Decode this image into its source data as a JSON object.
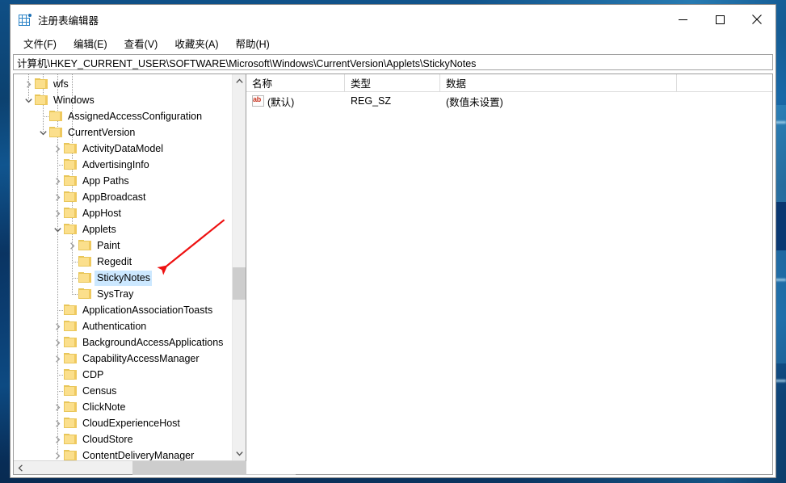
{
  "window": {
    "title": "注册表编辑器",
    "app_icon": "registry-editor-icon",
    "minimize_label": "最小化",
    "maximize_label": "最大化",
    "close_label": "关闭"
  },
  "menubar": {
    "items": [
      {
        "label": "文件(F)"
      },
      {
        "label": "编辑(E)"
      },
      {
        "label": "查看(V)"
      },
      {
        "label": "收藏夹(A)"
      },
      {
        "label": "帮助(H)"
      }
    ]
  },
  "address": {
    "path": "计算机\\HKEY_CURRENT_USER\\SOFTWARE\\Microsoft\\Windows\\CurrentVersion\\Applets\\StickyNotes"
  },
  "tree": {
    "items": [
      {
        "label": "wfs",
        "indent": 1,
        "expander": "collapsed",
        "selected": false
      },
      {
        "label": "Windows",
        "indent": 1,
        "expander": "expanded",
        "selected": false
      },
      {
        "label": "AssignedAccessConfiguration",
        "indent": 2,
        "expander": "none",
        "selected": false
      },
      {
        "label": "CurrentVersion",
        "indent": 2,
        "expander": "expanded",
        "selected": false
      },
      {
        "label": "ActivityDataModel",
        "indent": 3,
        "expander": "collapsed",
        "selected": false
      },
      {
        "label": "AdvertisingInfo",
        "indent": 3,
        "expander": "none",
        "selected": false
      },
      {
        "label": "App Paths",
        "indent": 3,
        "expander": "collapsed",
        "selected": false
      },
      {
        "label": "AppBroadcast",
        "indent": 3,
        "expander": "collapsed",
        "selected": false
      },
      {
        "label": "AppHost",
        "indent": 3,
        "expander": "collapsed",
        "selected": false
      },
      {
        "label": "Applets",
        "indent": 3,
        "expander": "expanded",
        "selected": false
      },
      {
        "label": "Paint",
        "indent": 4,
        "expander": "collapsed",
        "selected": false
      },
      {
        "label": "Regedit",
        "indent": 4,
        "expander": "none",
        "selected": false
      },
      {
        "label": "StickyNotes",
        "indent": 4,
        "expander": "none",
        "selected": true
      },
      {
        "label": "SysTray",
        "indent": 4,
        "expander": "none",
        "selected": false
      },
      {
        "label": "ApplicationAssociationToasts",
        "indent": 3,
        "expander": "none",
        "selected": false
      },
      {
        "label": "Authentication",
        "indent": 3,
        "expander": "collapsed",
        "selected": false
      },
      {
        "label": "BackgroundAccessApplications",
        "indent": 3,
        "expander": "collapsed",
        "selected": false
      },
      {
        "label": "CapabilityAccessManager",
        "indent": 3,
        "expander": "collapsed",
        "selected": false
      },
      {
        "label": "CDP",
        "indent": 3,
        "expander": "none",
        "selected": false
      },
      {
        "label": "Census",
        "indent": 3,
        "expander": "none",
        "selected": false
      },
      {
        "label": "ClickNote",
        "indent": 3,
        "expander": "collapsed",
        "selected": false
      },
      {
        "label": "CloudExperienceHost",
        "indent": 3,
        "expander": "collapsed",
        "selected": false
      },
      {
        "label": "CloudStore",
        "indent": 3,
        "expander": "collapsed",
        "selected": false
      },
      {
        "label": "ContentDeliveryManager",
        "indent": 3,
        "expander": "collapsed",
        "selected": false
      }
    ]
  },
  "values": {
    "columns": [
      "名称",
      "类型",
      "数据"
    ],
    "rows": [
      {
        "name": "(默认)",
        "type": "REG_SZ",
        "data": "(数值未设置)",
        "icon": "string-value-icon"
      }
    ]
  },
  "annotation": {
    "arrow_color": "#ee1111",
    "points_to": "StickyNotes"
  },
  "colors": {
    "selection": "#cce8ff",
    "folder": "#fbdf8c",
    "accent": "#2f86c8",
    "scrollbar_thumb": "#cdcdcd"
  }
}
